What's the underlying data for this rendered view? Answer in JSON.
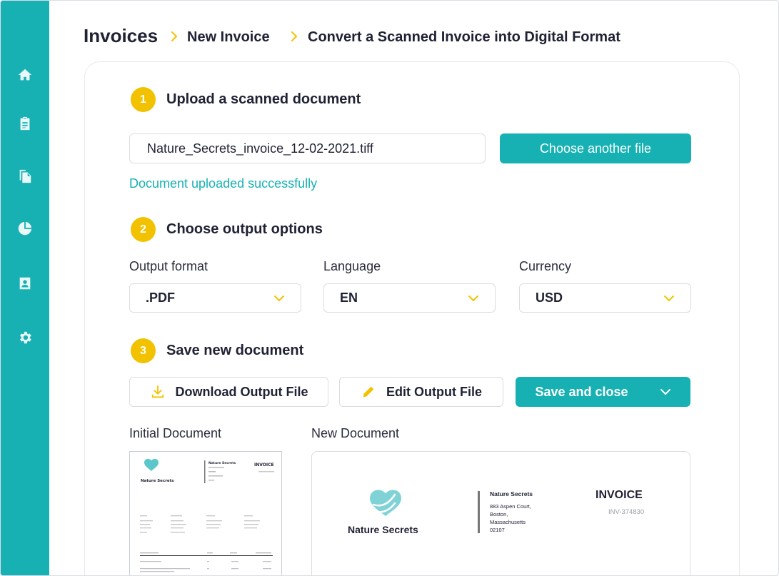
{
  "sidebar": {
    "items": [
      {
        "icon": "home-icon"
      },
      {
        "icon": "clipboard-icon"
      },
      {
        "icon": "documents-icon"
      },
      {
        "icon": "pie-chart-icon"
      },
      {
        "icon": "contact-card-icon"
      },
      {
        "icon": "gear-icon"
      }
    ],
    "accent": "#17b1b4"
  },
  "breadcrumb": {
    "items": [
      "Invoices",
      "New Invoice",
      "Convert a Scanned Invoice into Digital Format"
    ],
    "separator_icon": "chevron-right-icon"
  },
  "steps": {
    "upload": {
      "number": "1",
      "title": "Upload a scanned document",
      "file_name": "Nature_Secrets_invoice_12-02-2021.tiff",
      "choose_button": "Choose another file",
      "status": "Document uploaded successfully"
    },
    "options": {
      "number": "2",
      "title": "Choose output options",
      "output_format": {
        "label": "Output format",
        "value": ".PDF"
      },
      "language": {
        "label": "Language",
        "value": "EN"
      },
      "currency": {
        "label": "Currency",
        "value": "USD"
      }
    },
    "save": {
      "number": "3",
      "title": "Save new document",
      "download_button": "Download Output File",
      "edit_button": "Edit Output File",
      "save_button": "Save and close"
    }
  },
  "preview": {
    "initial_label": "Initial Document",
    "new_label": "New Document",
    "company": "Nature Secrets",
    "invoice_title": "INVOICE",
    "invoice_number": "INV-374830",
    "address": [
      "883 Aspen Court,",
      "Boston,",
      "Massachusetts",
      "02107"
    ]
  },
  "colors": {
    "teal": "#17b1b4",
    "yellow": "#f2c200",
    "text": "#1f2233"
  }
}
